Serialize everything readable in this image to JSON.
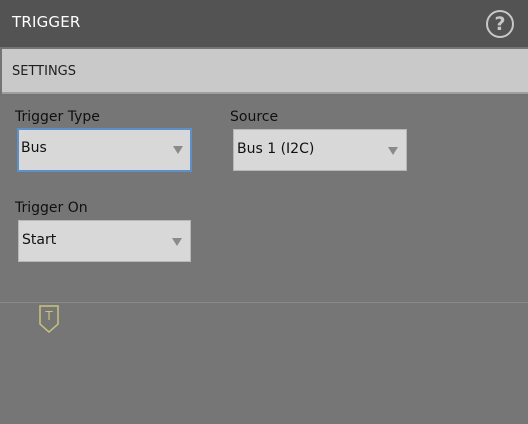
{
  "header": {
    "title": "TRIGGER",
    "help_icon": "help-circle-icon",
    "help_glyph": "?"
  },
  "settings": {
    "label": "SETTINGS"
  },
  "fields": {
    "trigger_type": {
      "label": "Trigger Type",
      "value": "Bus"
    },
    "source": {
      "label": "Source",
      "value": "Bus 1 (I2C)"
    },
    "trigger_on": {
      "label": "Trigger On",
      "value": "Start"
    }
  },
  "marker": {
    "icon": "trigger-level-marker-icon",
    "glyph": "T"
  },
  "colors": {
    "header_bg": "#535353",
    "panel_bg": "#747474",
    "settings_bg": "#c9c9c9",
    "dropdown_bg": "#d8d8d8",
    "focus_border": "#5d8fc9",
    "marker": "#c9c37c"
  }
}
